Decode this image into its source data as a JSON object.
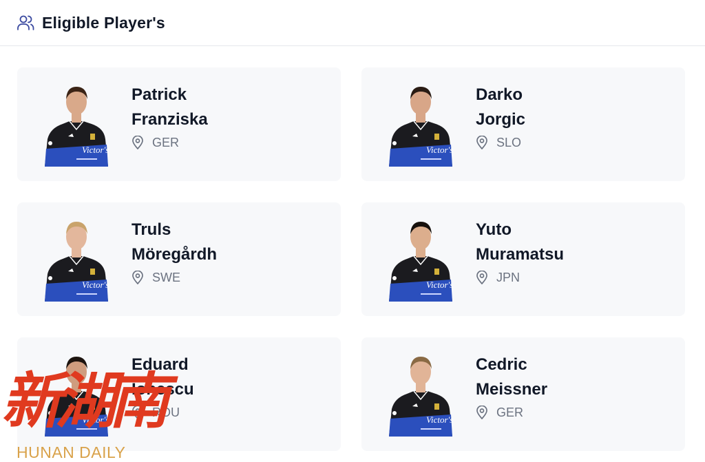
{
  "header": {
    "title": "Eligible Player's",
    "icon": "users-icon"
  },
  "players": [
    {
      "first": "Patrick",
      "last": "Franziska",
      "country": "GER",
      "hair": "#3b2416",
      "skin": "#d9a98a"
    },
    {
      "first": "Darko",
      "last": "Jorgic",
      "country": "SLO",
      "hair": "#2a1c14",
      "skin": "#d8a688"
    },
    {
      "first": "Truls",
      "last": "Möregårdh",
      "country": "SWE",
      "hair": "#c9a36b",
      "skin": "#e3b79c"
    },
    {
      "first": "Yuto",
      "last": "Muramatsu",
      "country": "JPN",
      "hair": "#17110d",
      "skin": "#dcae8d"
    },
    {
      "first": "Eduard",
      "last": "Ionescu",
      "country": "ROU",
      "hair": "#1d140f",
      "skin": "#cf9d7f"
    },
    {
      "first": "Cedric",
      "last": "Meissner",
      "country": "GER",
      "hair": "#8a6a44",
      "skin": "#e1b497"
    }
  ],
  "icons": {
    "location": "map-pin-icon"
  },
  "colors": {
    "card_bg": "#f7f8fa",
    "jersey_black": "#1b1b1f",
    "jersey_blue": "#2b4fbd",
    "muted": "#6b7280"
  },
  "watermark": {
    "cn": "新湖南",
    "en": "HUNAN DAILY"
  }
}
